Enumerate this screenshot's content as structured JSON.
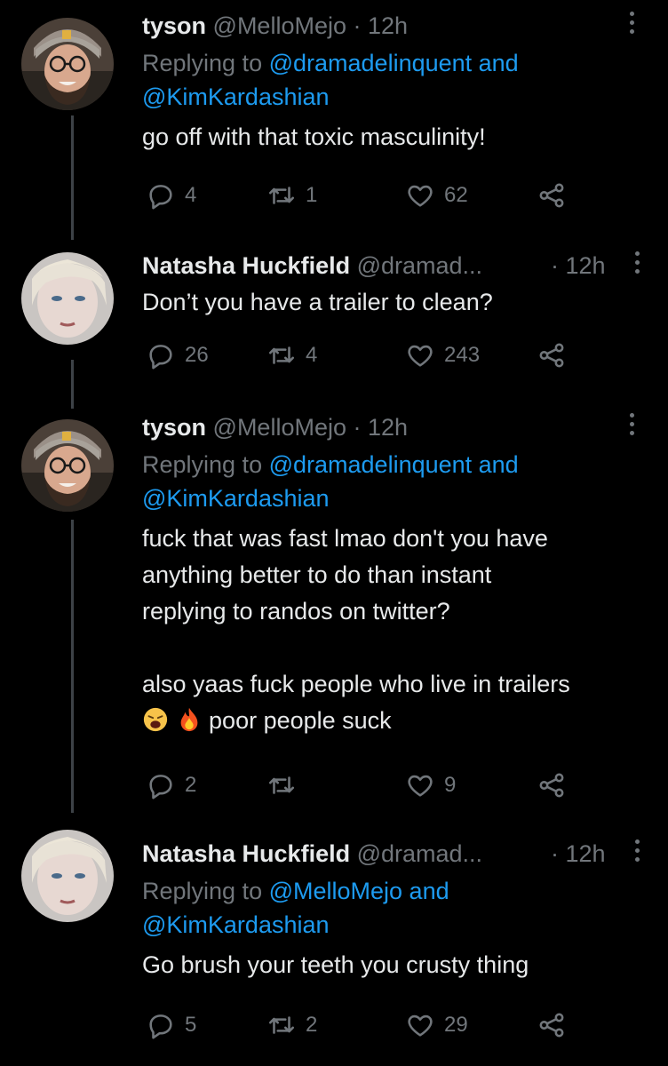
{
  "tweets": [
    {
      "name": "tyson",
      "handle": "@MelloMejo",
      "time": "· 12h",
      "replying_prefix": "Replying to ",
      "replying_to": "@dramadelinquent and",
      "replying_to2": "@KimKardashian",
      "text": [
        "go off with that toxic masculinity!"
      ],
      "replies": "4",
      "retweets": "1",
      "likes": "62"
    },
    {
      "name": "Natasha Huckfield",
      "handle": "@dramad...",
      "time": "· 12h",
      "text": [
        "Don’t you have a trailer to clean?"
      ],
      "replies": "26",
      "retweets": "4",
      "likes": "243"
    },
    {
      "name": "tyson",
      "handle": "@MelloMejo",
      "time": "· 12h",
      "replying_prefix": "Replying to ",
      "replying_to": "@dramadelinquent and",
      "replying_to2": "@KimKardashian",
      "text": [
        "fuck that was fast lmao don't you have",
        "anything better to do than instant",
        "replying to randos on twitter?",
        "also yaas fuck people who live in trailers",
        "poor people suck"
      ],
      "replies": "2",
      "retweets": "",
      "likes": "9"
    },
    {
      "name": "Natasha Huckfield",
      "handle": "@dramad...",
      "time": "· 12h",
      "replying_prefix": "Replying to ",
      "replying_to": "@MelloMejo and",
      "replying_to2": "@KimKardashian",
      "text": [
        "Go brush your teeth you crusty thing"
      ],
      "replies": "5",
      "retweets": "2",
      "likes": "29"
    }
  ],
  "emojis": [
    "weary-face",
    "fire"
  ],
  "colors": {
    "link": "#1d9bf0",
    "muted": "#71767b",
    "text": "#e7e9ea",
    "background": "#000000"
  }
}
